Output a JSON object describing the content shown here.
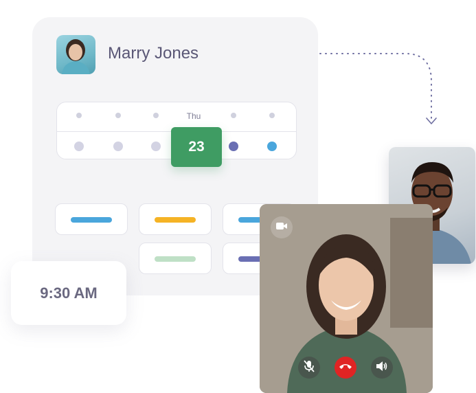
{
  "contact": {
    "name": "Marry Jones"
  },
  "calendar": {
    "day_label": "Thu",
    "selected_date": "23",
    "dot_colors": [
      "#d3d3e3",
      "#d3d3e3",
      "#d3d3e3",
      "#6a6fb3",
      "#4aa6dc"
    ]
  },
  "event_tags": [
    {
      "color": "#4aa6dc"
    },
    {
      "color": "#f5b325"
    },
    {
      "color": "#4aa6dc"
    },
    {
      "color": "#bfe0c6"
    },
    {
      "color": "#6a6fb3"
    }
  ],
  "appointment": {
    "time": "9:30 AM"
  },
  "call_controls": {
    "camera_icon": "video-camera-icon",
    "mute_icon": "microphone-muted-icon",
    "end_call_icon": "phone-hangup-icon",
    "speaker_icon": "speaker-icon",
    "end_call_color": "#e02424"
  }
}
